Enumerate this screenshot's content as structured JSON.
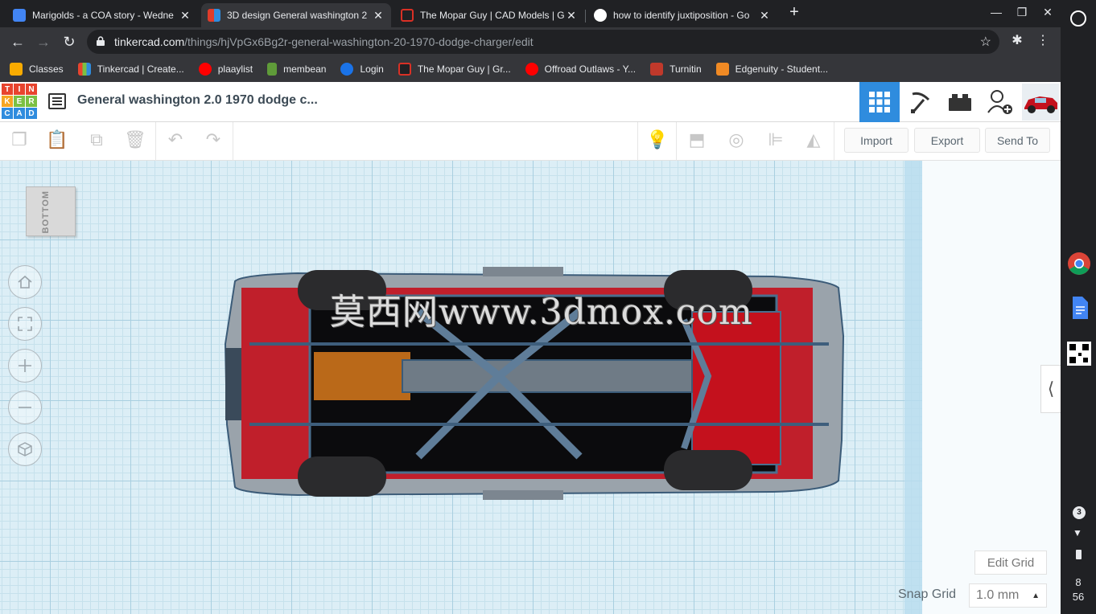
{
  "browser": {
    "tabs": [
      {
        "title": "Marigolds - a COA story - Wedne",
        "favicon_color": "#4285f4",
        "active": false
      },
      {
        "title": "3D design General washington 2",
        "favicon_color": "#e03c2a",
        "active": true
      },
      {
        "title": "The Mopar Guy | CAD Models | G",
        "favicon_color": "#d93025",
        "active": false
      },
      {
        "title": "how to identify juxtiposition - Go",
        "favicon_color": "#ffffff",
        "active": false
      }
    ],
    "close_glyph": "✕",
    "new_tab_glyph": "+",
    "window_controls": {
      "minimize": "—",
      "restore": "❐",
      "close": "✕"
    },
    "url_host": "tinkercad.com",
    "url_path": "/things/hjVpGx6Bg2r-general-washington-20-1970-dodge-charger/edit",
    "bookmarks": [
      {
        "label": "Classes",
        "icon_color": "#f9ab00"
      },
      {
        "label": "Tinkercad | Create...",
        "icon_color": "#34a853"
      },
      {
        "label": "plaaylist",
        "icon_color": "#ff0000"
      },
      {
        "label": "membean",
        "icon_color": "#5f9b39"
      },
      {
        "label": "Login",
        "icon_color": "#1a73e8"
      },
      {
        "label": "The Mopar Guy | Gr...",
        "icon_color": "#d93025"
      },
      {
        "label": "Offroad Outlaws - Y...",
        "icon_color": "#ff0000"
      },
      {
        "label": "Turnitin",
        "icon_color": "#c0392b"
      },
      {
        "label": "Edgenuity - Student...",
        "icon_color": "#f08a24"
      }
    ]
  },
  "tinkercad": {
    "logo_letters": [
      "TIN",
      "KER",
      "CAD"
    ],
    "logo_colors": [
      "#e8442e",
      "#f5a623",
      "#7bc043",
      "#2f8cde"
    ],
    "design_title": "General washington 2.0 1970 dodge c...",
    "header_buttons": [
      {
        "name": "3d-view-icon",
        "active": true
      },
      {
        "name": "pickaxe-icon",
        "active": false
      },
      {
        "name": "bricks-icon",
        "active": false
      },
      {
        "name": "add-user-icon",
        "active": false
      },
      {
        "name": "user-avatar-car-icon",
        "active": false
      }
    ],
    "toolbar": {
      "import_label": "Import",
      "export_label": "Export",
      "send_to_label": "Send To"
    },
    "viewcube_label": "BOTTOM",
    "nav_controls": [
      "home-view-icon",
      "fit-view-icon",
      "zoom-in-icon",
      "zoom-out-icon",
      "ortho-view-icon"
    ],
    "watermark": "莫西网www.3dmox.com",
    "edit_grid_label": "Edit Grid",
    "snap_grid_label": "Snap Grid",
    "snap_grid_value": "1.0 mm"
  },
  "shelf": {
    "notification_count": "3",
    "time_hour": "8",
    "time_minute": "56"
  },
  "colors": {
    "tinkercad_blue": "#2f8cde",
    "car_red": "#c4111d",
    "engine_orange": "#d97a1c",
    "workplane": "#dceef6"
  }
}
